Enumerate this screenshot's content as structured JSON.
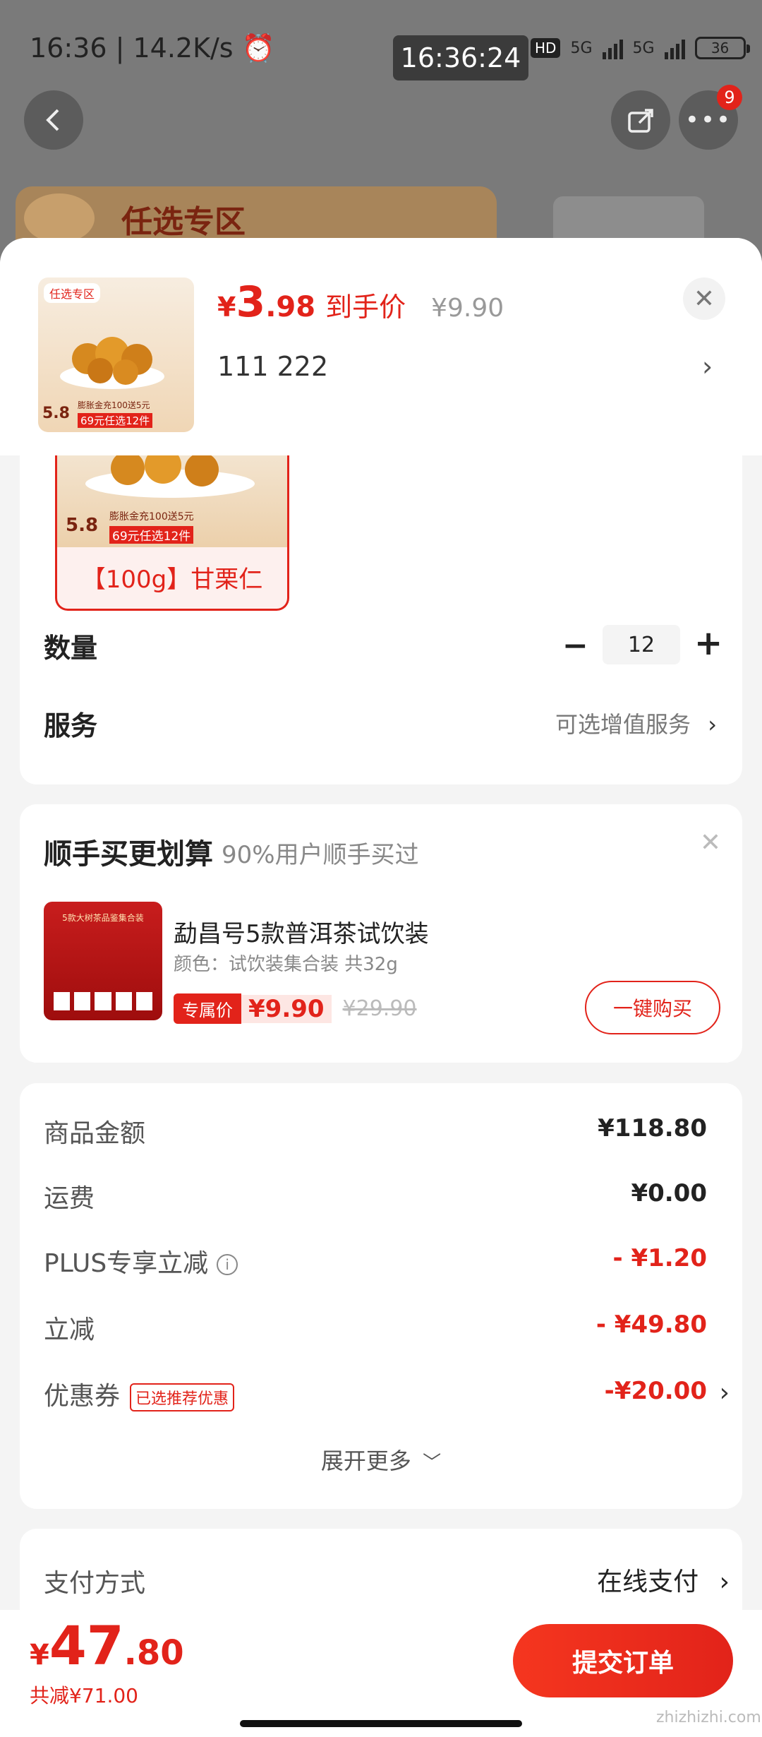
{
  "status_bar": {
    "left": "16:36 | 14.2K/s",
    "center_time": "16:36:24",
    "hd": "HD",
    "net1": "5G",
    "net2": "5G",
    "battery": "36"
  },
  "topbar": {
    "more_badge": "9"
  },
  "banner": {
    "title": "任选专区"
  },
  "product": {
    "img_tag": "任选专区",
    "img_price": "5.8",
    "img_promo1": "膨胀金充100送5元",
    "img_promo2": "69元任选12件",
    "price_yen": "¥",
    "price_int": "3",
    "price_dec": ".98",
    "price_tag": "到手价",
    "orig_price": "¥9.90",
    "spec": "111  222"
  },
  "variant": {
    "img_price": "5.8",
    "img_promo1": "膨胀金充100送5元",
    "img_promo2": "69元任选12件",
    "label": "【100g】甘栗仁"
  },
  "quantity": {
    "label": "数量",
    "minus": "−",
    "value": "12",
    "plus": "+"
  },
  "service": {
    "label": "服务",
    "value": "可选增值服务"
  },
  "addon": {
    "title": "顺手买更划算",
    "subtitle": "90%用户顺手买过",
    "item_name": "勐昌号5款普洱茶试饮装",
    "item_spec": "颜色：试饮装集合装 共32g",
    "tag": "专属价",
    "price": "¥9.90",
    "orig_price": "¥29.90",
    "buy_label": "一键购买",
    "img_text": "5款大树茶品鉴集合装"
  },
  "summary": {
    "goods_label": "商品金额",
    "goods_value": "¥118.80",
    "shipping_label": "运费",
    "shipping_value": "¥0.00",
    "plus_label": "PLUS专享立减",
    "plus_value": "- ¥1.20",
    "discount_label": "立减",
    "discount_value": "- ¥49.80",
    "coupon_label": "优惠券",
    "coupon_tag": "已选推荐优惠",
    "coupon_value": "-¥20.00",
    "more_label": "展开更多"
  },
  "payment": {
    "label": "支付方式",
    "value": "在线支付"
  },
  "bottom": {
    "total_yen": "¥",
    "total_int": "47",
    "total_dec": ".80",
    "saved": "共减¥71.00",
    "submit": "提交订单",
    "watermark": "zhizhizhi.com"
  },
  "colors": {
    "accent": "#e2231a"
  }
}
